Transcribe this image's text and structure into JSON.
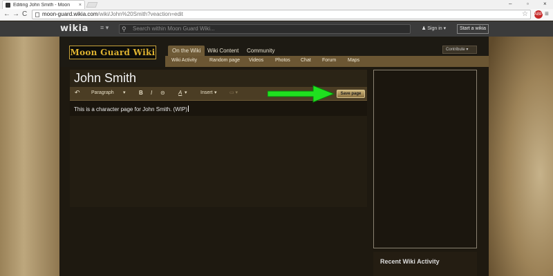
{
  "browser": {
    "tab_title": "Editing John Smith - Moon",
    "tab_close": "×",
    "url_host": "moon-guard.wikia.com",
    "url_path": "/wiki/John%20Smith?veaction=edit",
    "back": "←",
    "forward": "→",
    "reload": "C",
    "star": "☆",
    "menu": "≡",
    "minimize": "–",
    "maximize": "▫",
    "close": "×"
  },
  "wikia": {
    "logo": "wikia",
    "hamburger": "≡ ▾",
    "search_icon": "⚲",
    "search_placeholder": "Search within Moon Guard Wiki...",
    "signin": "Sign in ▾",
    "signin_icon": "♟",
    "start_wiki": "Start a wikia"
  },
  "wiki": {
    "wordmark": "Moon Guard Wiki",
    "nav": [
      "On the Wiki",
      "Wiki Content",
      "Community"
    ],
    "subnav": [
      "Wiki Activity",
      "Random page",
      "Videos",
      "Photos",
      "Chat",
      "Forum",
      "Maps"
    ],
    "contribute": "Contribute ▾"
  },
  "editor": {
    "page_title": "John Smith",
    "undo": "↶",
    "format": "Paragraph",
    "format_caret": "▾",
    "bold": "B",
    "italic": "I",
    "link": "⊝",
    "text_style": "A",
    "text_style_caret": "▾",
    "insert": "Insert",
    "insert_caret": "▾",
    "table": "▭ ▾",
    "save": "Save page",
    "content": "This is a character page for John Smith. (WIP)"
  },
  "rail": {
    "activity_title": "Recent Wiki Activity"
  },
  "colors": {
    "arrow": "#1fe01f",
    "wordmark": "#e0b431",
    "toolbar": "#4b3d24"
  }
}
